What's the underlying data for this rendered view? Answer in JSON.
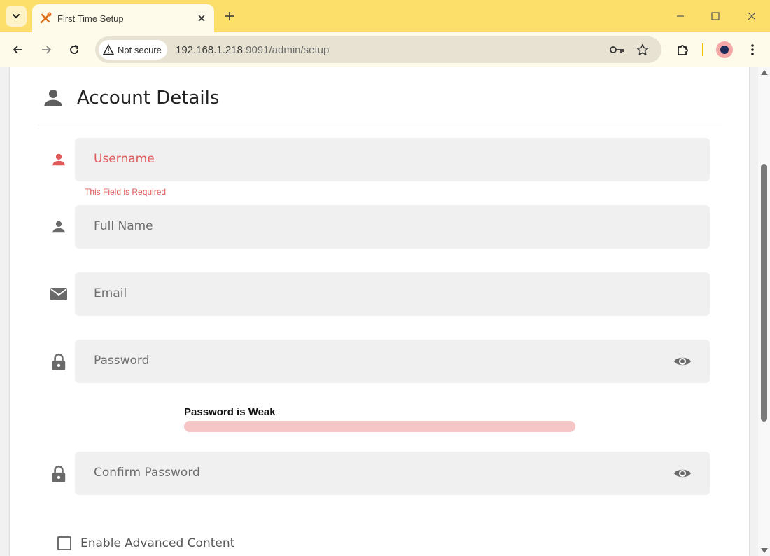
{
  "browser": {
    "tab_title": "First Time Setup",
    "security_label": "Not secure",
    "url_host": "192.168.1.218",
    "url_rest": ":9091/admin/setup"
  },
  "icons": {
    "tab_favicon": "tools-icon",
    "person": "person-icon",
    "email": "email-icon",
    "lock": "lock-icon",
    "eye": "eye-icon"
  },
  "colors": {
    "tabbar": "#fbdf6a",
    "error": "#e05a5a",
    "field_bg": "#f0f0f0",
    "strength_bar": "#f6c6c6"
  },
  "form": {
    "section_title": "Account Details",
    "username_label": "Username",
    "username_error": "This Field is Required",
    "fullname_label": "Full Name",
    "email_label": "Email",
    "password_label": "Password",
    "password_strength_label": "Password is Weak",
    "password_strength": 1.0,
    "confirm_password_label": "Confirm Password",
    "advanced_label": "Enable Advanced Content",
    "advanced_checked": false
  }
}
